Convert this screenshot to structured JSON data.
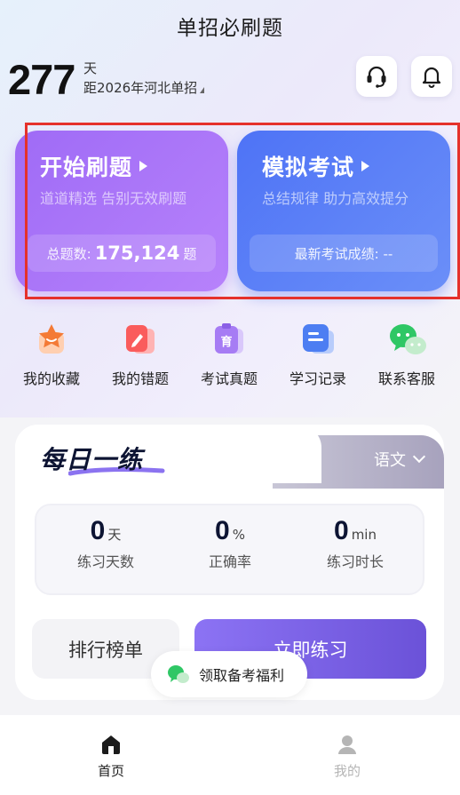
{
  "header": {
    "title": "单招必刷题"
  },
  "countdown": {
    "days": "277",
    "unit": "天",
    "description": "距2026年河北单招"
  },
  "icons": {
    "support": "headset-icon",
    "notifications": "bell-icon"
  },
  "cards": {
    "practice": {
      "title": "开始刷题",
      "subtitle": "道道精选 告别无效刷题",
      "count_label": "总题数:",
      "count_value": "175,124",
      "count_unit": "题",
      "color": "#a774f8"
    },
    "exam": {
      "title": "模拟考试",
      "subtitle": "总结规律 助力高效提分",
      "score_label": "最新考试成绩: --",
      "color": "#5b80f7"
    }
  },
  "quick_actions": [
    {
      "label": "我的收藏",
      "icon": "star-icon"
    },
    {
      "label": "我的错题",
      "icon": "pencil-icon"
    },
    {
      "label": "考试真题",
      "icon": "exam-paper-icon"
    },
    {
      "label": "学习记录",
      "icon": "record-icon"
    },
    {
      "label": "联系客服",
      "icon": "wechat-icon"
    }
  ],
  "daily": {
    "title": "每日一练",
    "subject": "语文",
    "stats": [
      {
        "value": "0",
        "unit": "天",
        "label": "练习天数"
      },
      {
        "value": "0",
        "unit": "%",
        "label": "正确率"
      },
      {
        "value": "0",
        "unit": "min",
        "label": "练习时长"
      }
    ],
    "rank_label": "排行榜单",
    "practice_label": "立即练习"
  },
  "welfare": {
    "label": "领取备考福利"
  },
  "nav": {
    "home": {
      "label": "首页",
      "active": true
    },
    "mine": {
      "label": "我的",
      "active": false
    }
  },
  "colors": {
    "accent_purple": "#8c73f4",
    "accent_blue": "#5b80f7",
    "nav_active": "#1b1b1b",
    "nav_inactive": "#b5b5b5"
  }
}
